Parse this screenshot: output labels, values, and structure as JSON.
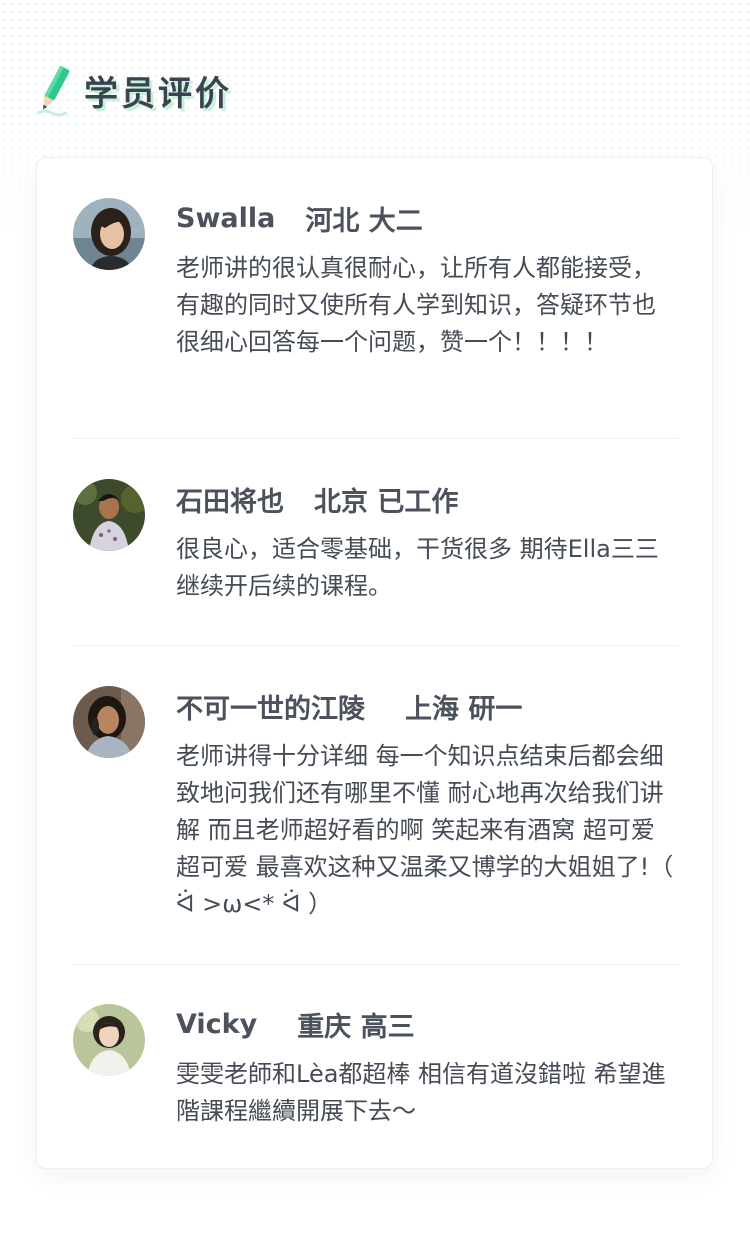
{
  "section": {
    "title": "学员评价",
    "icon": "pencil-icon"
  },
  "colors": {
    "accent": "#2ec88a",
    "title_shadow": "#c9f0dc",
    "text": "#454c55"
  },
  "reviews": [
    {
      "name": "Swalla",
      "info": "河北 大二",
      "comment": "老师讲的很认真很耐心，让所有人都能接受，有趣的同时又使所有人学到知识，答疑环节也很细心回答每一个问题，赞一个！！！！"
    },
    {
      "name": "石田将也",
      "info": "北京 已工作",
      "comment": "很良心，适合零基础，干货很多 期待Ella三三继续开后续的课程。"
    },
    {
      "name": "不可一世的江陵",
      "info": "上海 研一",
      "comment": "老师讲得十分详细 每一个知识点结束后都会细致地问我们还有哪里不懂 耐心地再次给我们讲解 而且老师超好看的啊 笑起来有酒窝 超可爱超可爱 最喜欢这种又温柔又博学的大姐姐了!（ ᐛ >ω<* ᐛ ）"
    },
    {
      "name": "Vicky",
      "info": "重庆 高三",
      "comment": "雯雯老師和Lèa都超棒 相信有道沒錯啦 希望進階課程繼續開展下去～"
    }
  ]
}
